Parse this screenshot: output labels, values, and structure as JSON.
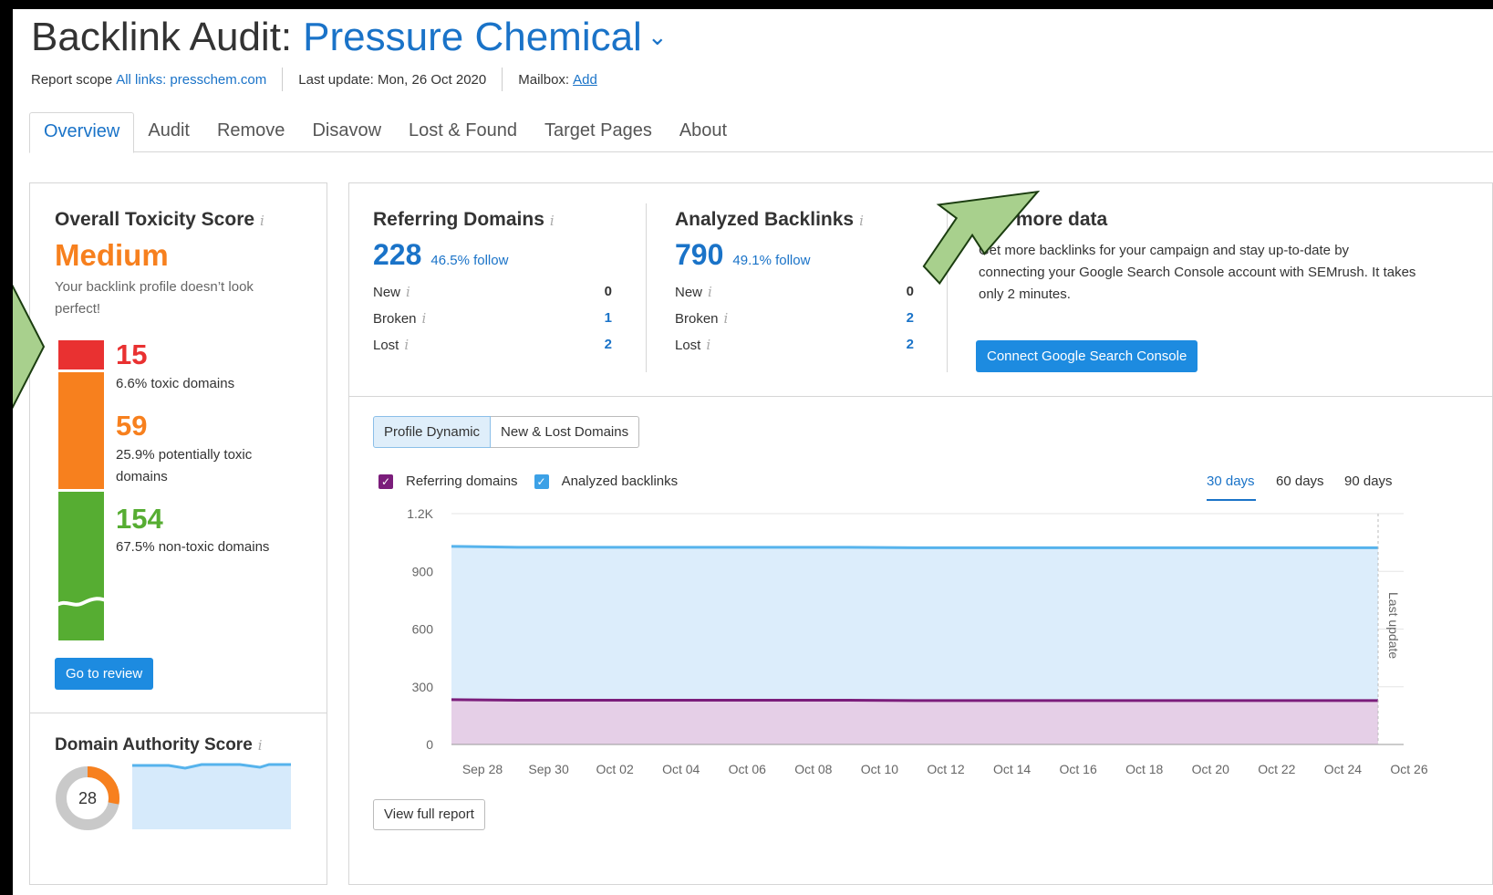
{
  "header": {
    "title": "Backlink Audit:",
    "domain": "Pressure Chemical",
    "report_scope_label": "Report scope",
    "report_scope_value": "All links: presschem.com",
    "last_update": "Last update: Mon, 26 Oct 2020",
    "mailbox_label": "Mailbox:",
    "mailbox_action": "Add"
  },
  "tabs": [
    "Overview",
    "Audit",
    "Remove",
    "Disavow",
    "Lost & Found",
    "Target Pages",
    "About"
  ],
  "toxicity": {
    "title": "Overall Toxicity Score",
    "score": "Medium",
    "description": "Your backlink profile doesn’t look perfect!",
    "toxic_count": "15",
    "toxic_label": "6.6% toxic domains",
    "potential_count": "59",
    "potential_label": "25.9% potentially toxic domains",
    "nontoxic_count": "154",
    "nontoxic_label": "67.5% non-toxic domains",
    "review_button": "Go to review",
    "colors": {
      "toxic": "#e93131",
      "potential": "#f7801e",
      "nontoxic": "#56ad32"
    }
  },
  "authority": {
    "title": "Domain Authority Score",
    "score": "28",
    "score_fraction": 0.28
  },
  "referring": {
    "title": "Referring Domains",
    "value": "228",
    "follow": "46.5% follow",
    "rows": [
      {
        "label": "New",
        "value": "0"
      },
      {
        "label": "Broken",
        "value": "1"
      },
      {
        "label": "Lost",
        "value": "2"
      }
    ]
  },
  "backlinks": {
    "title": "Analyzed Backlinks",
    "value": "790",
    "follow": "49.1% follow",
    "rows": [
      {
        "label": "New",
        "value": "0"
      },
      {
        "label": "Broken",
        "value": "2"
      },
      {
        "label": "Lost",
        "value": "2"
      }
    ]
  },
  "more_data": {
    "title": "Get more data",
    "text": "Get more backlinks for your campaign and stay up-to-date by connecting your Google Search Console account with SEMrush. It takes only 2 minutes.",
    "button": "Connect Google Search Console"
  },
  "chart_tabs": [
    "Profile Dynamic",
    "New & Lost Domains"
  ],
  "legend": {
    "referring": "Referring domains",
    "backlinks": "Analyzed backlinks"
  },
  "ranges": [
    "30 days",
    "60 days",
    "90 days"
  ],
  "view_full_report": "View full report",
  "chart_data": {
    "type": "area",
    "categories": [
      "Sep 28",
      "Sep 30",
      "Oct 02",
      "Oct 04",
      "Oct 06",
      "Oct 08",
      "Oct 10",
      "Oct 12",
      "Oct 14",
      "Oct 16",
      "Oct 18",
      "Oct 20",
      "Oct 22",
      "Oct 24",
      "Oct 26"
    ],
    "yticks": [
      "0",
      "300",
      "600",
      "900",
      "1.2K"
    ],
    "ylim": [
      0,
      1200
    ],
    "series": [
      {
        "name": "Analyzed backlinks",
        "color": "#56b3ec",
        "fill": "#dcedfb",
        "values": [
          1030,
          1025,
          1025,
          1025,
          1025,
          1025,
          1025,
          1023,
          1023,
          1023,
          1023,
          1023,
          1023,
          1023,
          1023
        ]
      },
      {
        "name": "Referring domains",
        "color": "#7b1d7b",
        "fill": "#e5cfe7",
        "values": [
          233,
          230,
          230,
          230,
          230,
          230,
          230,
          228,
          228,
          228,
          228,
          228,
          228,
          228,
          228
        ]
      }
    ],
    "annotation": "Last update",
    "grid": true
  }
}
